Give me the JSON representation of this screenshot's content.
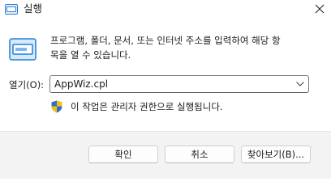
{
  "window": {
    "title": "실행",
    "title_icon": "run-icon",
    "close_icon": "close-icon"
  },
  "main": {
    "icon": "run-dialog-icon",
    "description_line1": "프로그램, 폴더, 문서, 또는 인터넷 주소를 입력하여 해당 항",
    "description_line2": "목을 열 수 있습니다."
  },
  "open_field": {
    "label": "열기(O):",
    "value": "AppWiz.cpl",
    "dropdown_icon": "chevron-down-icon"
  },
  "admin_note": {
    "icon": "uac-shield-icon",
    "text": "이 작업은 관리자 권한으로 실행됩니다."
  },
  "buttons": {
    "ok_label": "확인",
    "cancel_label": "취소",
    "browse_label": "찾아보기(B)..."
  },
  "colors": {
    "accent": "#0067c0",
    "footer_background": "#f3f3f3"
  }
}
